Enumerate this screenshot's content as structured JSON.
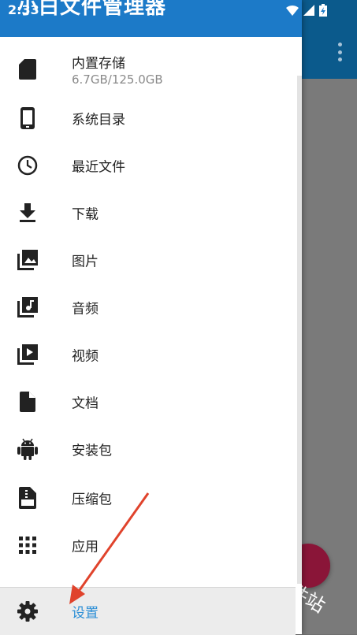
{
  "status_bar": {
    "time": "2:33"
  },
  "drawer": {
    "header_title": "小白文件管理器",
    "storage": {
      "label": "内置存储",
      "detail": "6.7GB/125.0GB"
    },
    "items": [
      {
        "label": "系统目录",
        "icon": "phone-icon"
      },
      {
        "label": "最近文件",
        "icon": "clock-icon"
      },
      {
        "label": "下载",
        "icon": "download-icon"
      },
      {
        "label": "图片",
        "icon": "image-icon"
      },
      {
        "label": "音频",
        "icon": "music-icon"
      },
      {
        "label": "视频",
        "icon": "video-icon"
      },
      {
        "label": "文档",
        "icon": "document-icon"
      },
      {
        "label": "安装包",
        "icon": "android-icon"
      },
      {
        "label": "压缩包",
        "icon": "zip-icon"
      },
      {
        "label": "应用",
        "icon": "apps-grid-icon"
      }
    ],
    "settings_label": "设置"
  },
  "watermark": "软件站",
  "colors": {
    "header_blue": "#1c7ac8",
    "toolbar_blue": "#0b5a8c",
    "settings_blue": "#2a8ed6",
    "fab": "#8a1538",
    "arrow": "#e0432c"
  }
}
